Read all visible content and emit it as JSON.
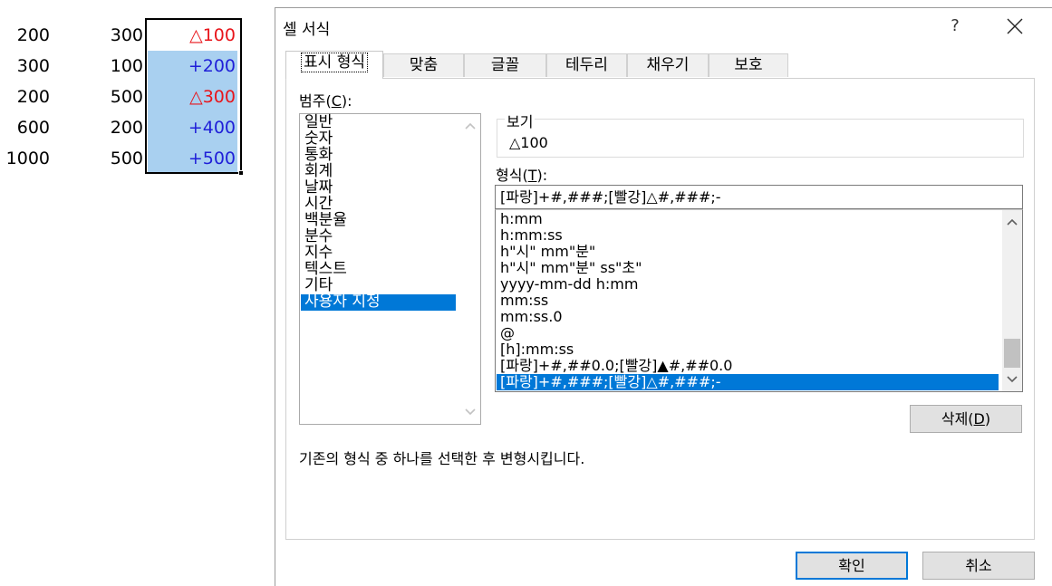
{
  "sheet": {
    "rows": [
      {
        "a": "200",
        "b": "300",
        "c": "△100",
        "c_color": "red"
      },
      {
        "a": "300",
        "b": "100",
        "c": "+200",
        "c_color": "blue"
      },
      {
        "a": "200",
        "b": "500",
        "c": "△300",
        "c_color": "red"
      },
      {
        "a": "600",
        "b": "200",
        "c": "+400",
        "c_color": "blue"
      },
      {
        "a": "1000",
        "b": "500",
        "c": "+500",
        "c_color": "blue"
      }
    ]
  },
  "dialog": {
    "title": "셀 서식",
    "help": "?",
    "tabs": [
      {
        "label": "표시 형식",
        "active": true
      },
      {
        "label": "맞춤"
      },
      {
        "label": "글꼴"
      },
      {
        "label": "테두리"
      },
      {
        "label": "채우기"
      },
      {
        "label": "보호"
      }
    ],
    "category_label": "범주(",
    "category_key": "C",
    "category_label_end": "):",
    "categories": [
      "일반",
      "숫자",
      "통화",
      "회계",
      "날짜",
      "시간",
      "백분율",
      "분수",
      "지수",
      "텍스트",
      "기타",
      "사용자 지정"
    ],
    "selected_category": "사용자 지정",
    "preview_label": "보기",
    "preview_value": "△100",
    "format_label": "형식(",
    "format_key": "T",
    "format_label_end": "):",
    "format_value": "[파랑]+#,###;[빨강]△#,###;-",
    "formats": [
      "h:mm",
      "h:mm:ss",
      "h\"시\" mm\"분\"",
      "h\"시\" mm\"분\" ss\"초\"",
      "yyyy-mm-dd h:mm",
      "mm:ss",
      "mm:ss.0",
      "@",
      "[h]:mm:ss",
      "[파랑]+#,##0.0;[빨강]▲#,##0.0",
      "[파랑]+#,###;[빨강]△#,###;-"
    ],
    "selected_format": "[파랑]+#,###;[빨강]△#,###;-",
    "delete_label": "삭제(",
    "delete_key": "D",
    "delete_label_end": ")",
    "description": "기존의 형식 중 하나를 선택한 후 변형시킵니다.",
    "ok_label": "확인",
    "cancel_label": "취소"
  },
  "colors": {
    "red": "#e8151b",
    "blue": "#1f1fd8",
    "selection": "#0078d7",
    "cell_selection": "#a9d0f0"
  }
}
